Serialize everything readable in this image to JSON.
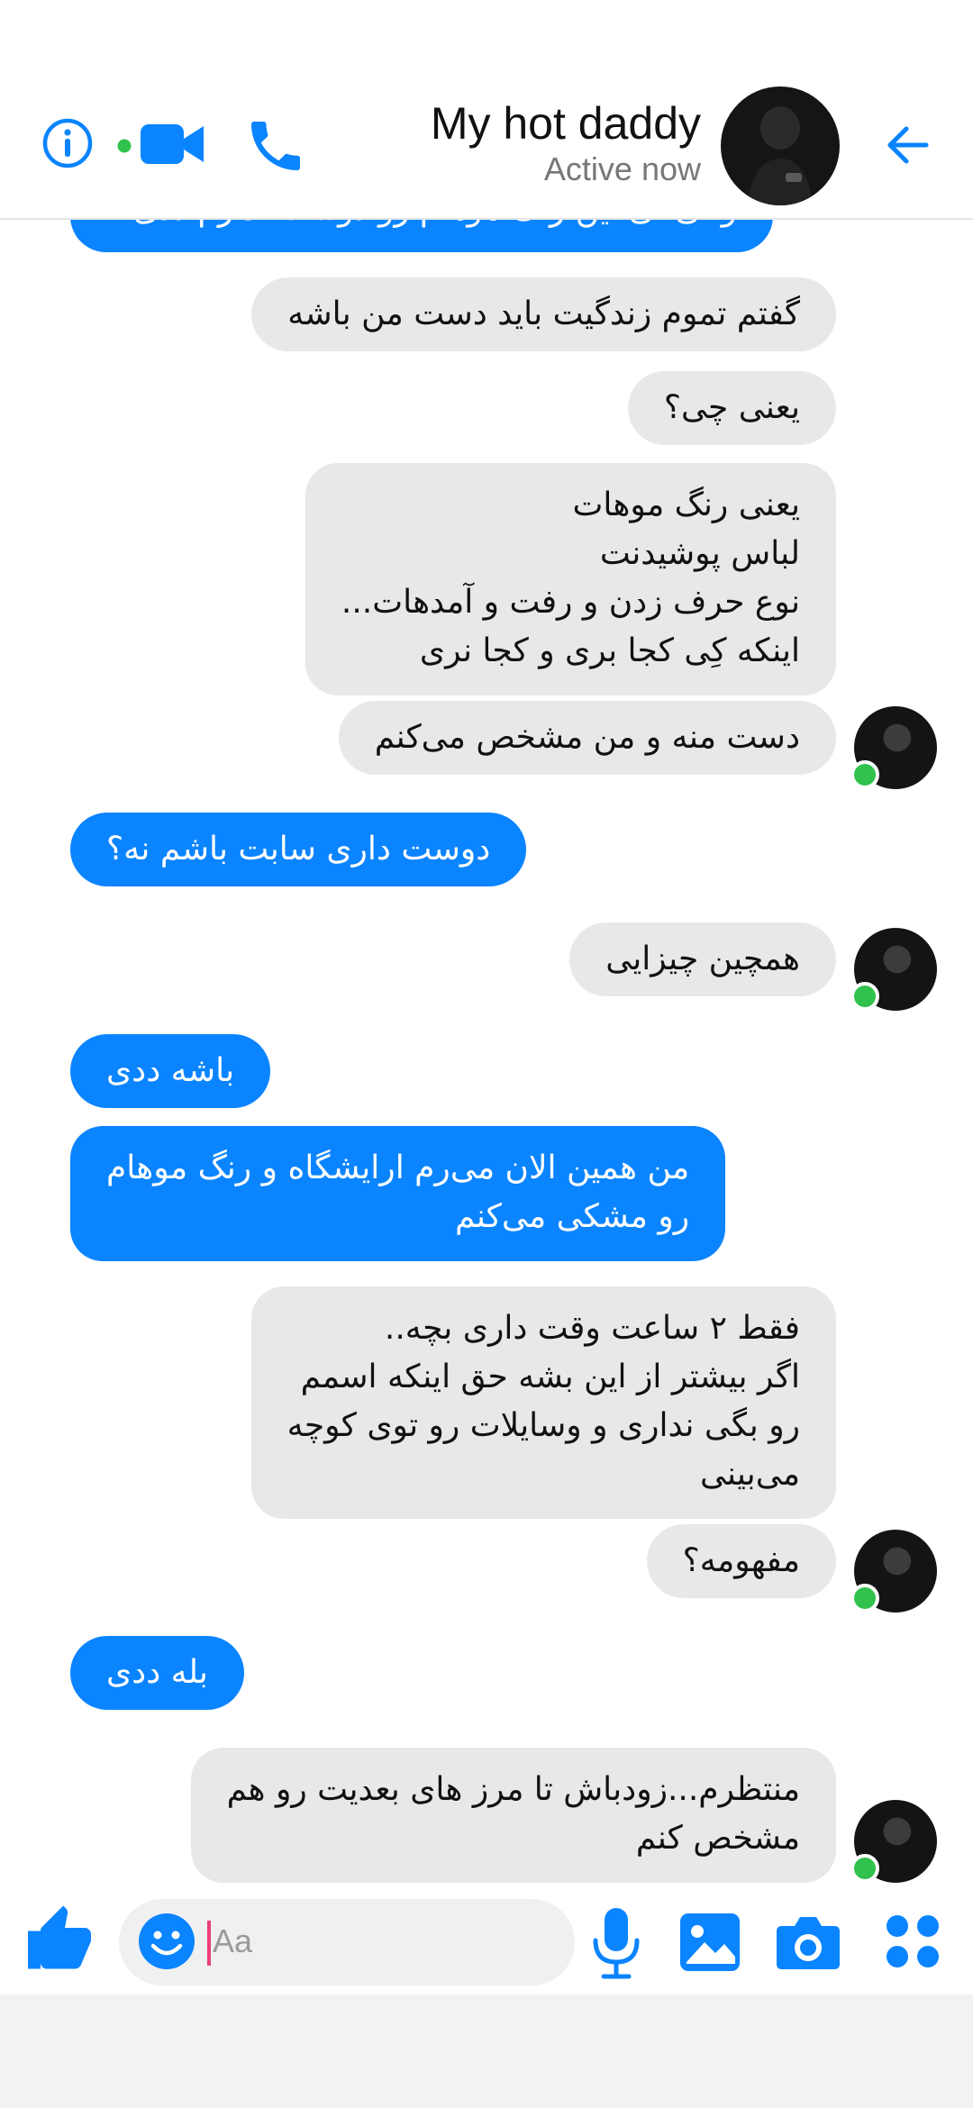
{
  "header": {
    "contact_name": "My hot daddy",
    "status": "Active now",
    "icons": [
      "info-icon",
      "video-camera-icon",
      "phone-icon",
      "back-arrow-icon"
    ],
    "accent_color": "#0a84ff",
    "online_color": "#31c24d"
  },
  "messages": [
    {
      "direction": "out",
      "text": "و تی تی این رنگ موهام رو دوست ندارم ددی"
    },
    {
      "direction": "in",
      "text": "گفتم تموم زندگیت باید دست من باشه"
    },
    {
      "direction": "in",
      "text": "یعنی چی؟"
    },
    {
      "direction": "in",
      "text": "یعنی رنگ موهات\nلباس پوشیدنت\nنوع حرف زدن و رفت و آمدهات...\nاینکه کِی کجا بری و کجا نری"
    },
    {
      "direction": "in",
      "text": "دست منه و من مشخص می‌کنم"
    },
    {
      "direction": "out",
      "text": "دوست داری سابت باشم نه؟"
    },
    {
      "direction": "in",
      "text": "همچین چیزایی"
    },
    {
      "direction": "out",
      "text": "باشه ددی"
    },
    {
      "direction": "out",
      "text": "من همین الان می‌رم ارایشگاه و رنگ موهام\nرو مشکی می‌کنم"
    },
    {
      "direction": "in",
      "text": "فقط ۲ ساعت وقت داری بچه..\nاگر بیشتر از این بشه حق اینکه اسمم\nرو بگی نداری و وسایلات رو توی کوچه\nمی‌بینی"
    },
    {
      "direction": "in",
      "text": "مفهومه؟"
    },
    {
      "direction": "out",
      "text": "بله ددی"
    },
    {
      "direction": "in",
      "text": "منتظرم...زودباش تا مرز های بعدیت رو هم\nمشخص کنم"
    }
  ],
  "composer": {
    "placeholder": "Aa",
    "icons": [
      "thumbs-up-icon",
      "emoji-icon",
      "microphone-icon",
      "gallery-icon",
      "camera-icon",
      "more-apps-icon"
    ]
  }
}
